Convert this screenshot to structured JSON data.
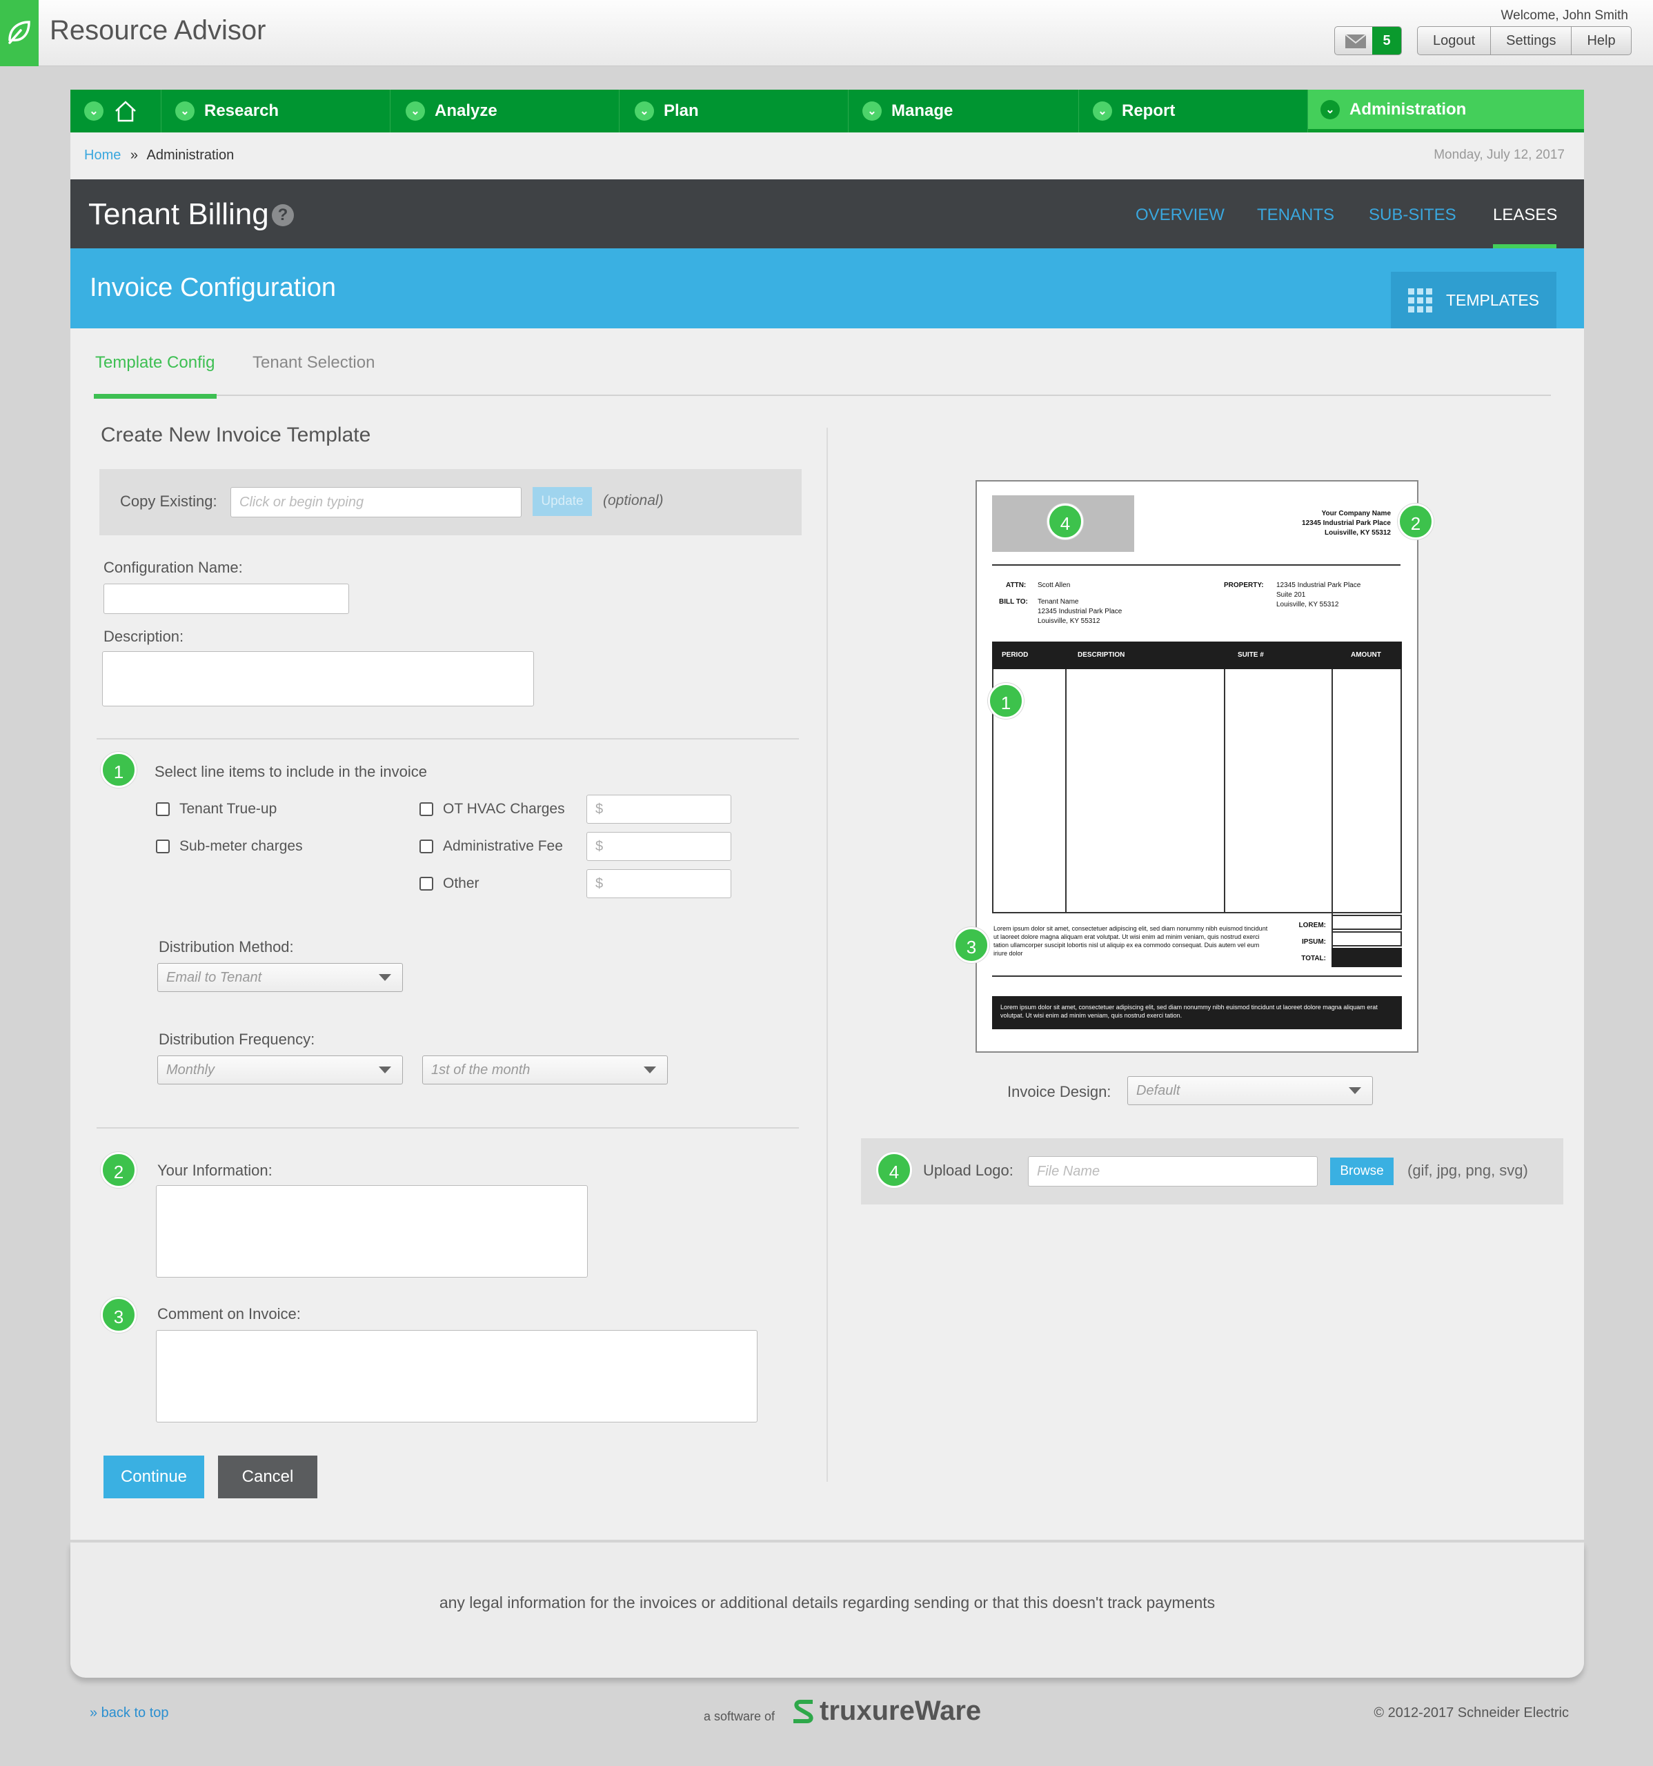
{
  "header": {
    "app_title": "Resource Advisor",
    "welcome": "Welcome, John Smith",
    "mail_count": "5",
    "buttons": [
      "Logout",
      "Settings",
      "Help"
    ]
  },
  "nav": {
    "items": [
      "Research",
      "Analyze",
      "Plan",
      "Manage",
      "Report",
      "Administration"
    ]
  },
  "breadcrumb": {
    "home": "Home",
    "sep": "»",
    "current": "Administration"
  },
  "date": "Monday, July 12, 2017",
  "page": {
    "title": "Tenant Billing",
    "help": "?",
    "tabs": [
      "OVERVIEW",
      "TENANTS",
      "SUB-SITES",
      "LEASES"
    ],
    "active_tab": "LEASES"
  },
  "section": {
    "title": "Invoice Configuration",
    "templates_label": "TEMPLATES"
  },
  "subtabs": {
    "config": "Template Config",
    "selection": "Tenant Selection"
  },
  "form": {
    "heading": "Create New Invoice Template",
    "copy_label": "Copy Existing:",
    "copy_placeholder": "Click or begin typing",
    "update_label": "Update",
    "optional": "(optional)",
    "config_name_label": "Configuration Name:",
    "description_label": "Description:",
    "step1": "1",
    "step1_label": "Select line items to include in the invoice",
    "items_left": [
      "Tenant True-up",
      "Sub-meter charges"
    ],
    "items_right": [
      "OT HVAC Charges",
      "Administrative Fee",
      "Other"
    ],
    "dollar": "$",
    "dist_method_label": "Distribution Method:",
    "dist_method_value": "Email to Tenant",
    "dist_freq_label": "Distribution Frequency:",
    "dist_freq_value": "Monthly",
    "dist_day_value": "1st of the month",
    "step2": "2",
    "your_info_label": "Your Information:",
    "step3": "3",
    "comment_label": "Comment on Invoice:",
    "continue": "Continue",
    "cancel": "Cancel"
  },
  "invoice": {
    "company": "Your Company Name",
    "addr1": "12345 Industrial Park Place",
    "addr2": "Louisville, KY 55312",
    "attn_label": "ATTN:",
    "attn_value": "Scott Allen",
    "bill_label": "BILL TO:",
    "bill1": "Tenant Name",
    "bill2": "12345 Industrial Park Place",
    "bill3": "Louisville, KY 55312",
    "prop_label": "PROPERTY:",
    "prop1": "12345 Industrial Park Place",
    "prop2": "Suite 201",
    "prop3": "Louisville, KY 55312",
    "cols": [
      "PERIOD",
      "DESCRIPTION",
      "SUITE #",
      "AMOUNT"
    ],
    "lorem_note": "Lorem ipsum dolor sit amet, consectetuer adipiscing elit, sed diam nonummy nibh euismod tincidunt ut laoreet dolore magna aliquam erat volutpat. Ut wisi enim ad minim veniam, quis nostrud exerci tation ullamcorper suscipit lobortis nisl ut aliquip ex ea commodo consequat. Duis autem vel eum iriure dolor",
    "totals": [
      "LOREM:",
      "IPSUM:",
      "TOTAL:"
    ],
    "footer_text": "Lorem ipsum dolor sit amet, consectetuer adipiscing elit, sed diam nonummy nibh euismod tincidunt ut laoreet dolore magna aliquam erat volutpat. Ut wisi enim ad minim veniam, quis nostrud exerci tation.",
    "markers": [
      "4",
      "2",
      "1",
      "3"
    ]
  },
  "design": {
    "label": "Invoice Design:",
    "value": "Default"
  },
  "upload": {
    "step": "4",
    "label": "Upload Logo:",
    "placeholder": "File Name",
    "browse": "Browse",
    "formats": "(gif, jpg, png, svg)"
  },
  "legal": "any legal information for the invoices or additional details regarding sending or that this doesn't track payments",
  "footer": {
    "back": "» back to top",
    "software": "a software of",
    "brand": "truxureWare",
    "copyright": "© 2012-2017 Schneider Electric"
  },
  "colors": {
    "green": "#009531",
    "accent_green": "#3dc24c",
    "blue": "#3ab0e2",
    "dark": "#3f4245"
  }
}
